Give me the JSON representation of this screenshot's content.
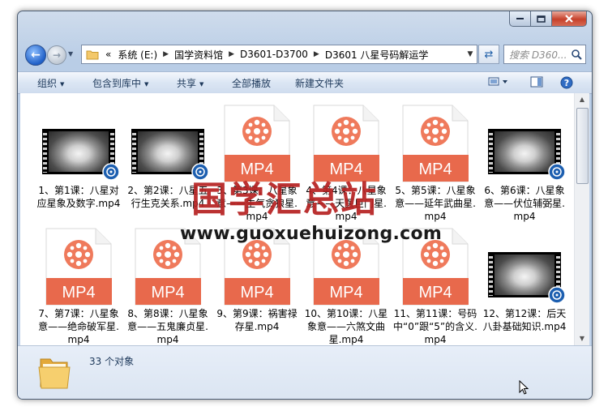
{
  "window": {
    "caption_buttons": [
      "minimize",
      "maximize",
      "close"
    ]
  },
  "address": {
    "overflow": "«",
    "crumbs": [
      "系统 (E:)",
      "国学资料馆",
      "D3601-D3700",
      "D3601 八星号码解运学"
    ],
    "search_placeholder": "搜索 D360..."
  },
  "toolbar": {
    "organize": "组织",
    "include_library": "包含到库中",
    "share": "共享",
    "play_all": "全部播放",
    "new_folder": "新建文件夹"
  },
  "files": [
    {
      "name": "1、第1课：八星对应星象及数字.mp4",
      "kind": "video"
    },
    {
      "name": "2、第2课：八星五行生克关系.mp4",
      "kind": "video"
    },
    {
      "name": "3、第3课：八星象意——生气贪狼星.mp4",
      "kind": "mp4"
    },
    {
      "name": "4、第4课：八星象意——天医巨门星.mp4",
      "kind": "mp4"
    },
    {
      "name": "5、第5课：八星象意——延年武曲星.mp4",
      "kind": "mp4"
    },
    {
      "name": "6、第6课：八星象意——伏位辅弼星.mp4",
      "kind": "video"
    },
    {
      "name": "7、第7课：八星象意——绝命破军星.mp4",
      "kind": "mp4"
    },
    {
      "name": "8、第8课：八星象意——五鬼廉贞星.mp4",
      "kind": "mp4"
    },
    {
      "name": "9、第9课：祸害禄存星.mp4",
      "kind": "mp4"
    },
    {
      "name": "10、第10课：八星象意——六煞文曲星.mp4",
      "kind": "mp4"
    },
    {
      "name": "11、第11课：号码中“0”跟“5”的含义.mp4",
      "kind": "mp4"
    },
    {
      "name": "12、第12课：后天八卦基础知识.mp4",
      "kind": "video"
    }
  ],
  "mp4_label": "MP4",
  "details": {
    "count": "33 个对象"
  },
  "watermark": {
    "big": "国学汇总站",
    "url": "www.guoxuehuizong.com"
  },
  "colors": {
    "mp4_accent": "#ef7a5c",
    "mp4_badge": "#e8694c",
    "watermark_red": "#b62121"
  }
}
